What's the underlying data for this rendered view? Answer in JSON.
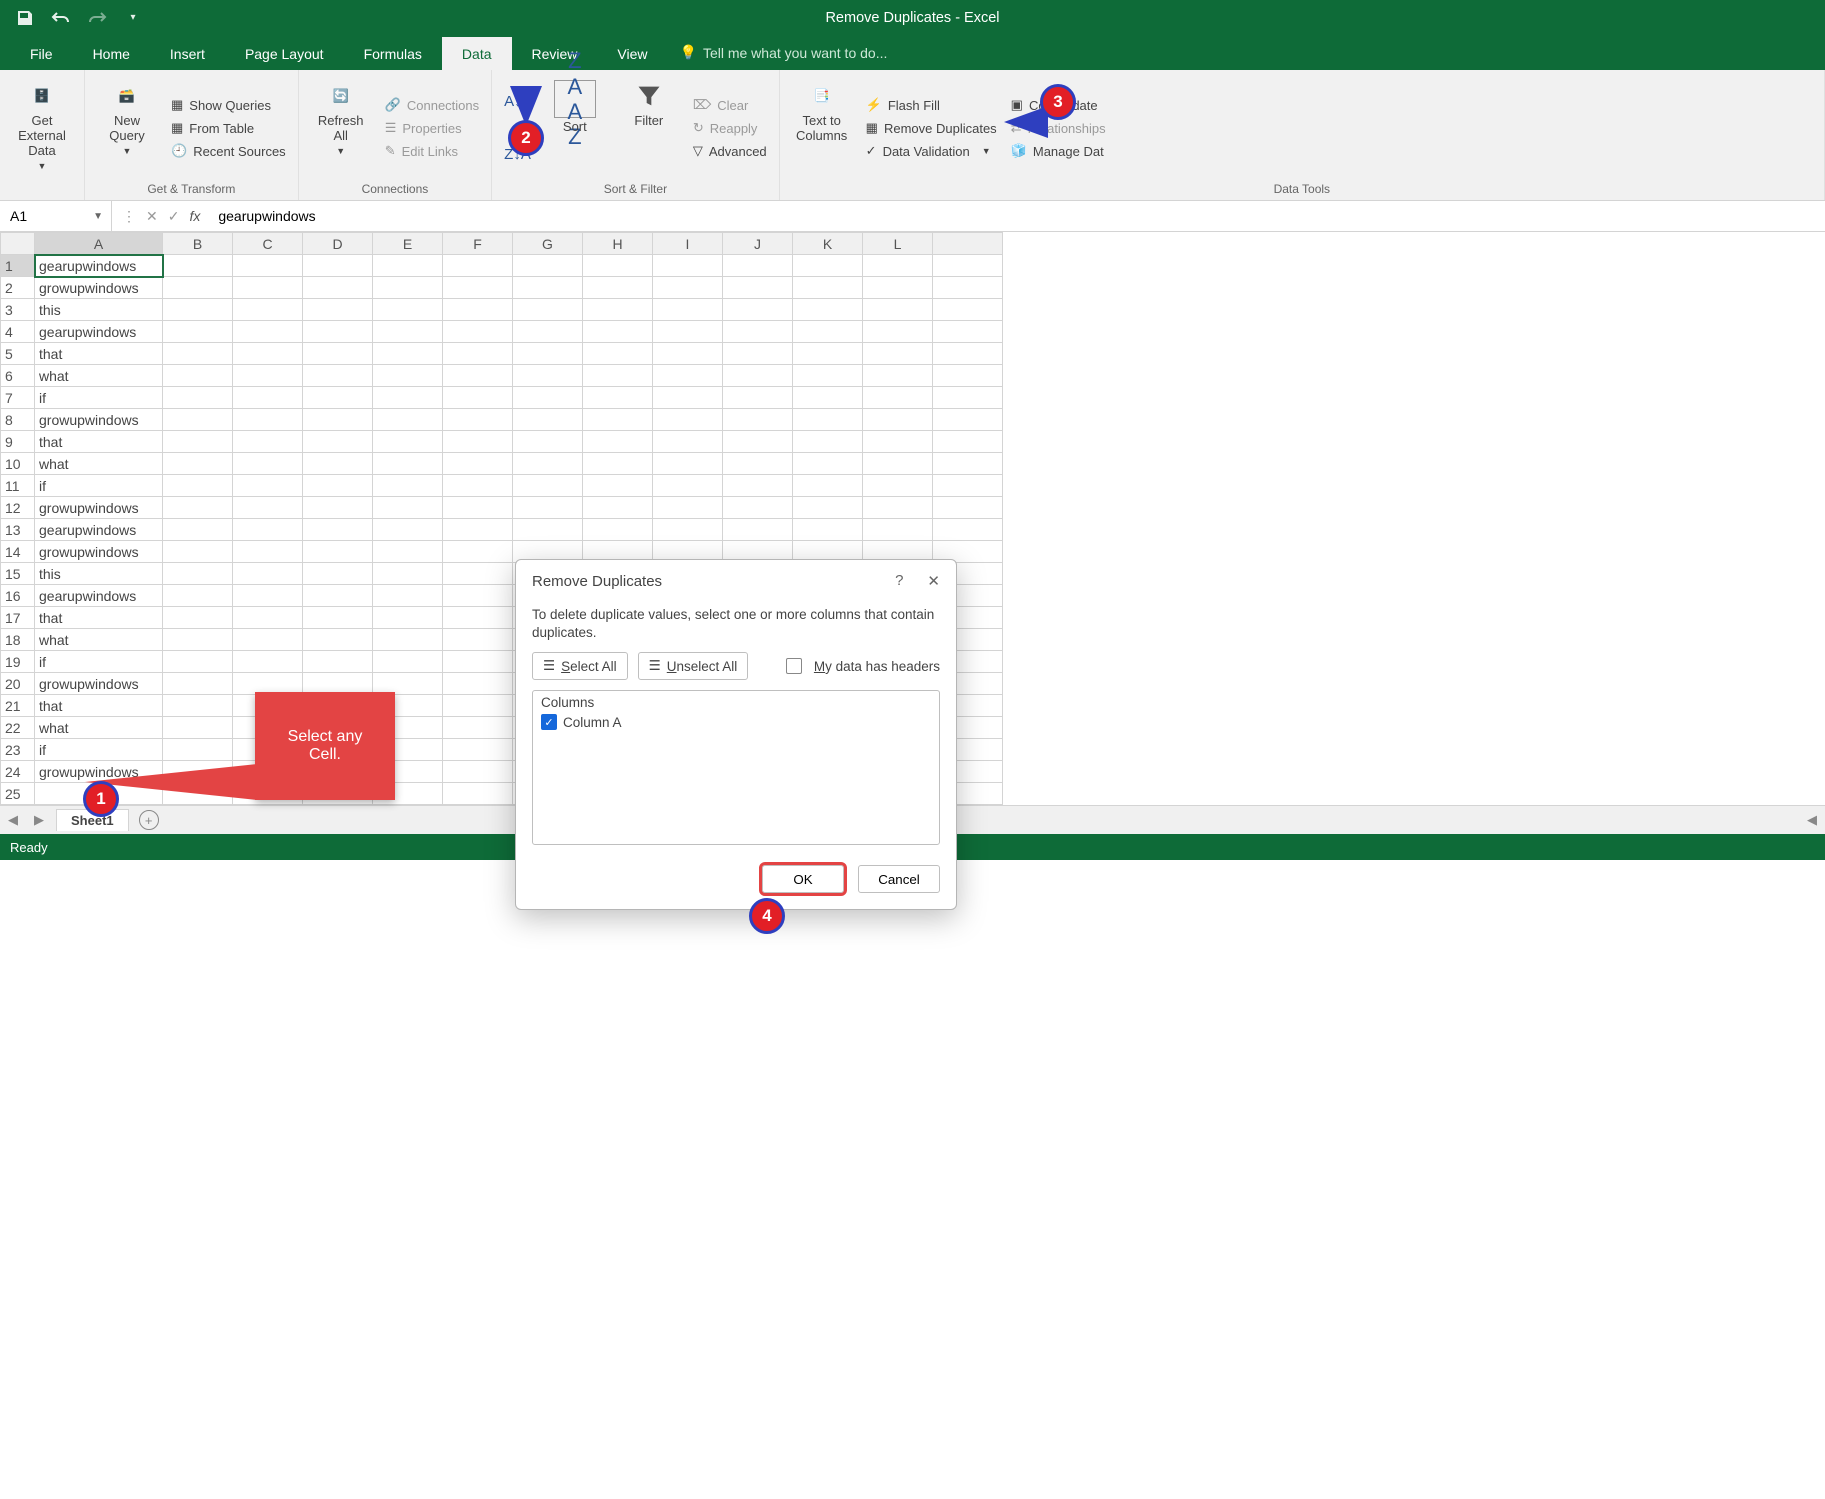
{
  "title": "Remove Duplicates - Excel",
  "tabs": [
    "File",
    "Home",
    "Insert",
    "Page Layout",
    "Formulas",
    "Data",
    "Review",
    "View"
  ],
  "active_tab": "Data",
  "tellme": "Tell me what you want to do...",
  "ribbon": {
    "get_external": "Get External\nData",
    "new_query": "New\nQuery",
    "show_queries": "Show Queries",
    "from_table": "From Table",
    "recent_sources": "Recent Sources",
    "group_get": "Get & Transform",
    "refresh": "Refresh\nAll",
    "connections": "Connections",
    "properties": "Properties",
    "edit_links": "Edit Links",
    "group_conn": "Connections",
    "sort": "Sort",
    "filter": "Filter",
    "clear": "Clear",
    "reapply": "Reapply",
    "advanced": "Advanced",
    "group_sort": "Sort & Filter",
    "text_cols": "Text to\nColumns",
    "flash_fill": "Flash Fill",
    "remove_dup": "Remove Duplicates",
    "data_val": "Data Validation",
    "consolidate": "Consolidate",
    "relationships": "Relationships",
    "manage_dm": "Manage Dat",
    "group_tools": "Data Tools"
  },
  "namebox": "A1",
  "formula": "gearupwindows",
  "columns": [
    "A",
    "B",
    "C",
    "D",
    "E",
    "F",
    "G",
    "H",
    "I",
    "J",
    "K",
    "L"
  ],
  "rows": [
    "gearupwindows",
    "growupwindows",
    "this",
    "gearupwindows",
    "that",
    "what",
    "if",
    "growupwindows",
    "that",
    "what",
    "if",
    "growupwindows",
    "gearupwindows",
    "growupwindows",
    "this",
    "gearupwindows",
    "that",
    "what",
    "if",
    "growupwindows",
    "that",
    "what",
    "if",
    "growupwindows",
    ""
  ],
  "sheet_tab": "Sheet1",
  "status": "Ready",
  "callout": "Select any\nCell.",
  "dialog": {
    "title": "Remove Duplicates",
    "desc": "To delete duplicate values, select one or more columns that contain duplicates.",
    "select_all": "Select All",
    "unselect_all": "Unselect All",
    "headers": "My data has headers",
    "columns_hdr": "Columns",
    "col_item": "Column A",
    "ok": "OK",
    "cancel": "Cancel"
  }
}
